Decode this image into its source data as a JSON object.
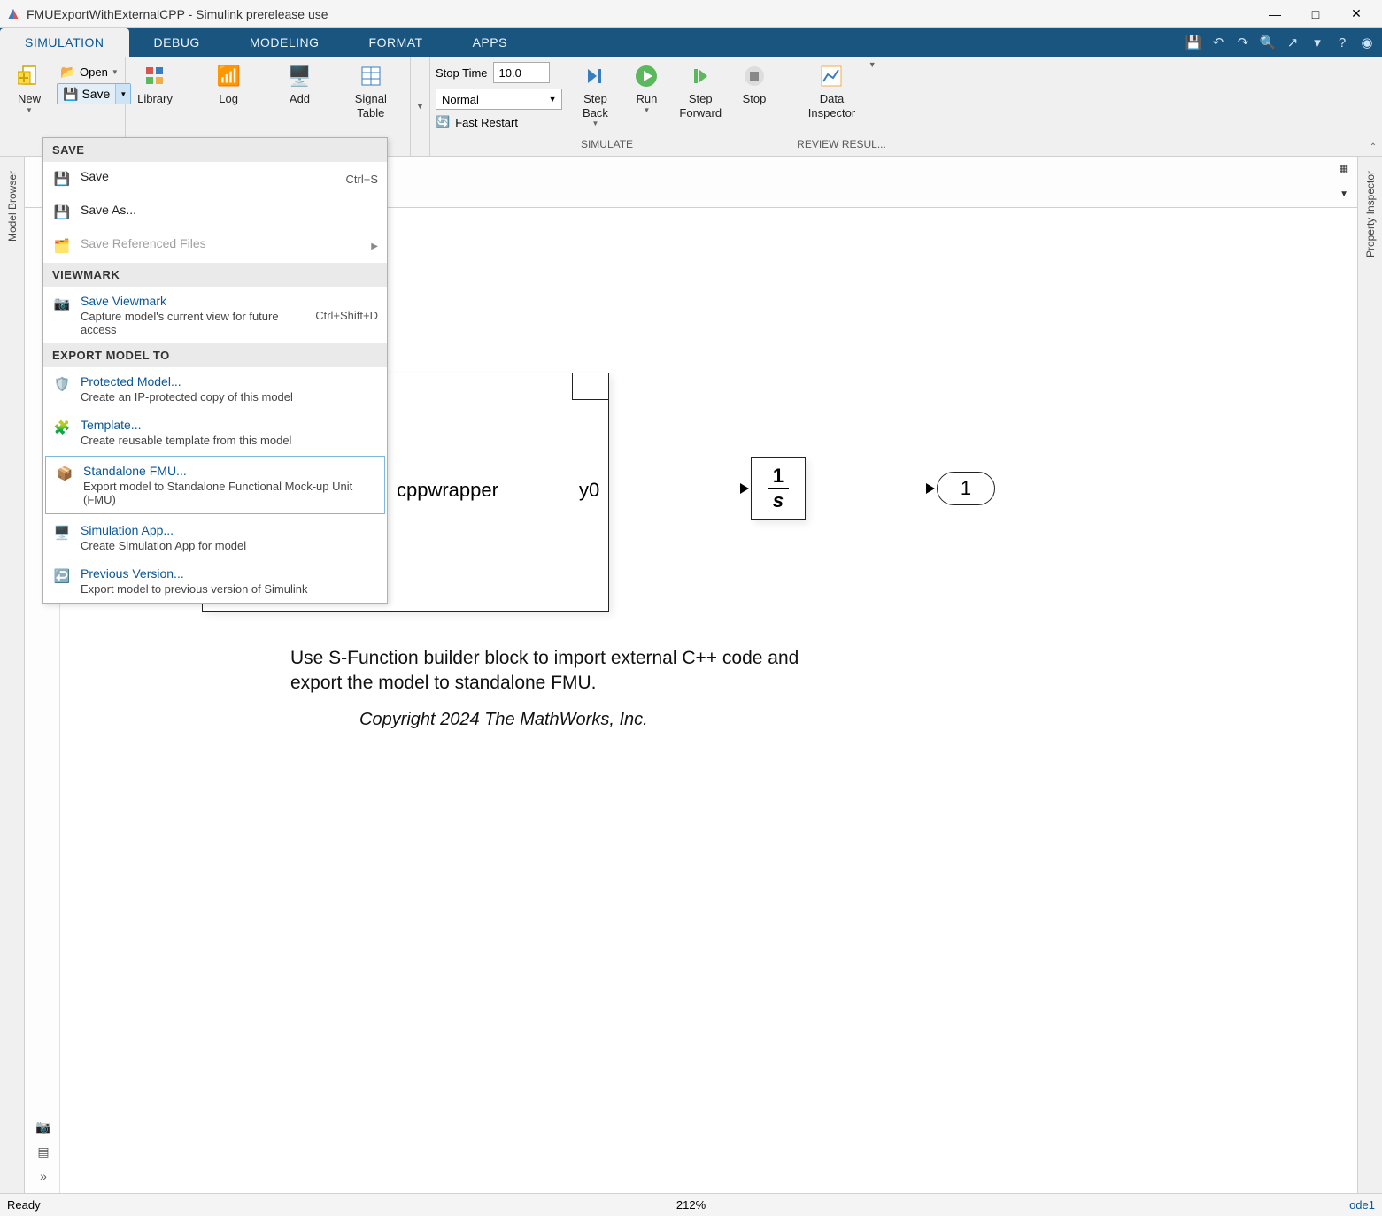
{
  "window": {
    "title": "FMUExportWithExternalCPP - Simulink prerelease use"
  },
  "tabs": [
    "SIMULATION",
    "DEBUG",
    "MODELING",
    "FORMAT",
    "APPS"
  ],
  "active_tab_index": 0,
  "toolstrip": {
    "new": "New",
    "open": "Open",
    "save": "Save",
    "library": "Library",
    "log": "Log",
    "add": "Add",
    "signal_table": "Signal\nTable",
    "sim_group": {
      "stop_time_label": "Stop Time",
      "stop_time_value": "10.0",
      "mode": "Normal",
      "fast_restart": "Fast Restart"
    },
    "step_back": "Step\nBack",
    "run": "Run",
    "step_forward": "Step\nForward",
    "stop": "Stop",
    "data_inspector": "Data\nInspector",
    "group_simulate": "SIMULATE",
    "group_review": "REVIEW RESUL..."
  },
  "docks": {
    "model_browser": "Model Browser",
    "property_inspector": "Property Inspector"
  },
  "save_menu": {
    "section_save": "SAVE",
    "save": {
      "title": "Save",
      "shortcut": "Ctrl+S"
    },
    "save_as": {
      "title": "Save As..."
    },
    "save_ref": {
      "title": "Save Referenced Files"
    },
    "section_viewmark": "VIEWMARK",
    "save_viewmark": {
      "title": "Save Viewmark",
      "sub": "Capture model's current view for future access",
      "shortcut": "Ctrl+Shift+D"
    },
    "section_export": "EXPORT MODEL TO",
    "protected": {
      "title": "Protected Model...",
      "sub": "Create an IP-protected copy of this model"
    },
    "template": {
      "title": "Template...",
      "sub": "Create reusable template from this model"
    },
    "standalone_fmu": {
      "title": "Standalone FMU...",
      "sub": "Export model to Standalone Functional Mock-up Unit (FMU)"
    },
    "sim_app": {
      "title": "Simulation App...",
      "sub": "Create Simulation App for model"
    },
    "prev_version": {
      "title": "Previous Version...",
      "sub": "Export model to previous version of Simulink"
    }
  },
  "canvas": {
    "sfun_label": "cppwrapper",
    "port_y0": "y0",
    "outport": "1",
    "text_main": "Use S-Function builder block to import external C++ code and export the model to standalone FMU.",
    "text_copyright": "Copyright 2024 The MathWorks, Inc."
  },
  "status": {
    "left": "Ready",
    "zoom": "212%",
    "solver": "ode1"
  }
}
